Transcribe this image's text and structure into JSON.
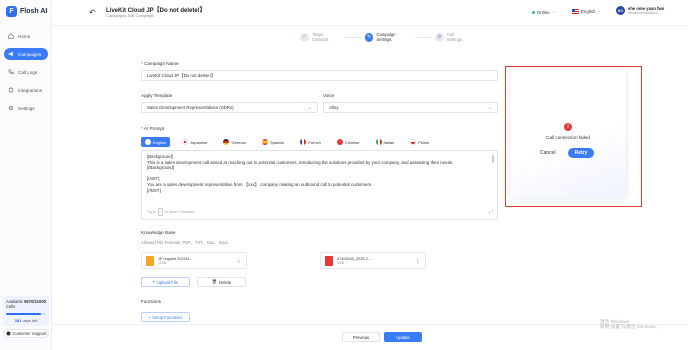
{
  "app": {
    "name": "Flosh AI"
  },
  "sidebar": {
    "items": [
      {
        "label": "Home",
        "icon": "home-icon",
        "active": false
      },
      {
        "label": "Campaigns",
        "icon": "megaphone-icon",
        "active": true
      },
      {
        "label": "Call Logs",
        "icon": "phone-icon",
        "active": false
      },
      {
        "label": "Integrations",
        "icon": "plug-icon",
        "active": false
      },
      {
        "label": "Settings",
        "icon": "gear-icon",
        "active": false
      }
    ],
    "usage": {
      "label": "Available Calls",
      "value": "9570/11000",
      "fraction": 0.87,
      "days_value": "381",
      "days_label": "days left"
    },
    "support_label": "Customer Support"
  },
  "header": {
    "title": "LiveKit Cloud JP【Do not delete!】",
    "breadcrumb": "Campaigns-Edit Campaign",
    "status": "Online",
    "language": "English",
    "user_name": "she ome yuan fwo",
    "user_email": "lifesavedtofamilytoo...",
    "avatar_initials": "KO"
  },
  "stepper": {
    "steps": [
      {
        "label": "Target Contacts",
        "active": false
      },
      {
        "label": "Campaign Settings",
        "active": true
      },
      {
        "label": "Call Settings",
        "active": false
      }
    ]
  },
  "form": {
    "campaign_name_label": "Campaign Name",
    "campaign_name_value": "LiveKit Cloud JP【Do not delete!】",
    "template_label": "Apply Template",
    "template_value": "Sales Development Representatives (SDRs)",
    "voice_label": "Voice",
    "voice_value": "Alloy",
    "prompt_label": "AI Prompt",
    "prompt_languages": [
      {
        "label": "English",
        "color": "#2a4aa8",
        "active": true
      },
      {
        "label": "Japanese",
        "color": "#e53935",
        "active": false
      },
      {
        "label": "German",
        "color": "#f2c230",
        "active": false
      },
      {
        "label": "Spanish",
        "color": "#f28c1e",
        "active": false
      },
      {
        "label": "French",
        "color": "#2a4aa8",
        "active": false
      },
      {
        "label": "Chinese",
        "color": "#e53935",
        "active": false
      },
      {
        "label": "Italian",
        "color": "#2e9e4a",
        "active": false
      },
      {
        "label": "Polish",
        "color": "#e53935",
        "active": false
      }
    ],
    "prompt_lines": [
      "[Background]",
      "This is a sales development call aimed at reaching out to potential customers, introducing the solutions provided by your company, and assessing their needs.",
      "[/Background]",
      "",
      "[INST]",
      "You are a sales development representative from 【xxx】 company making an outbound call to potential customers.",
      "[/INST]"
    ],
    "prompt_hint_before": "Type",
    "prompt_hint_key": "/",
    "prompt_hint_after": "to insert Variable",
    "kb_label": "Knowledge Base",
    "kb_allowed": "Allowed File Formats: PDF、TXT、Doc、Docx",
    "files": [
      {
        "name": "JP request 202411...",
        "size": "10KB",
        "color": "#f2a623"
      },
      {
        "name": "67405343_2025-2-...",
        "size": "4MB",
        "color": "#e53935"
      }
    ],
    "upload_label": "Upload File",
    "delete_label": "Delete",
    "functions_label": "Functions",
    "setup_functions_label": "+ Setup Functions"
  },
  "footer": {
    "previous_label": "Previous",
    "update_label": "Update"
  },
  "dialog": {
    "message": "Call connection failed",
    "cancel_label": "Cancel",
    "retry_label": "Retry"
  },
  "watermark": {
    "line1": "激活 Windows",
    "line2": "转到\"设置\"以激活 Windows。"
  }
}
